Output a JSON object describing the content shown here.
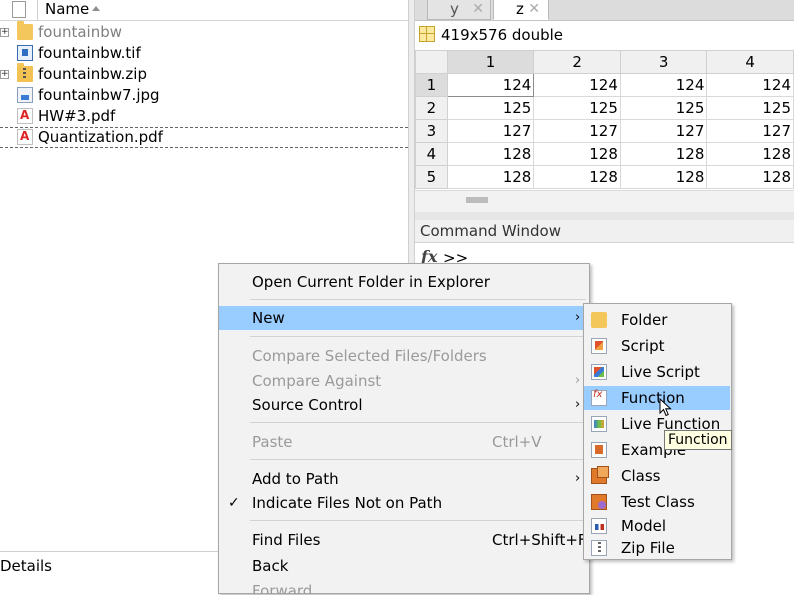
{
  "folder_panel": {
    "name_header": "Name",
    "files": [
      {
        "name": "fountainbw",
        "icon": "folder-icon",
        "expandable": true,
        "dim": true
      },
      {
        "name": "fountainbw.tif",
        "icon": "image-file-icon",
        "expandable": false,
        "dim": false
      },
      {
        "name": "fountainbw.zip",
        "icon": "zip-folder-icon",
        "expandable": true,
        "dim": false
      },
      {
        "name": "fountainbw7.jpg",
        "icon": "image-file-icon",
        "expandable": false,
        "dim": false
      },
      {
        "name": "HW#3.pdf",
        "icon": "pdf-file-icon",
        "expandable": false,
        "dim": false
      },
      {
        "name": "Quantization.pdf",
        "icon": "pdf-file-icon",
        "expandable": false,
        "dim": false
      }
    ],
    "details_label": "Details"
  },
  "variables": {
    "tabs": [
      {
        "label": "y",
        "close": "✕"
      },
      {
        "label": "z",
        "close": "✕"
      }
    ],
    "dims": "419x576 double",
    "columns": [
      "1",
      "2",
      "3",
      "4"
    ],
    "rows": [
      {
        "index": "1",
        "values": [
          "124",
          "124",
          "124",
          "124"
        ]
      },
      {
        "index": "2",
        "values": [
          "125",
          "125",
          "125",
          "125"
        ]
      },
      {
        "index": "3",
        "values": [
          "127",
          "127",
          "127",
          "127"
        ]
      },
      {
        "index": "4",
        "values": [
          "128",
          "128",
          "128",
          "128"
        ]
      },
      {
        "index": "5",
        "values": [
          "128",
          "128",
          "128",
          "128"
        ]
      }
    ]
  },
  "command_window": {
    "title": "Command Window",
    "fx": "fx",
    "prompt": ">>"
  },
  "context_menu": {
    "open_in_explorer": "Open Current Folder in Explorer",
    "new": "New",
    "compare_selected": "Compare Selected Files/Folders",
    "compare_against": "Compare Against",
    "source_control": "Source Control",
    "paste": "Paste",
    "paste_shortcut": "Ctrl+V",
    "add_to_path": "Add to Path",
    "indicate_not_on_path": "Indicate Files Not on Path",
    "find_files": "Find Files",
    "find_files_shortcut": "Ctrl+Shift+F",
    "back": "Back",
    "forward": "Forward",
    "submenu_arrow": "›",
    "check": "✓"
  },
  "new_submenu": {
    "items": [
      {
        "label": "Folder",
        "icon": "folder-icon"
      },
      {
        "label": "Script",
        "icon": "script-icon"
      },
      {
        "label": "Live Script",
        "icon": "live-script-icon"
      },
      {
        "label": "Function",
        "icon": "function-icon"
      },
      {
        "label": "Live Function",
        "icon": "live-function-icon"
      },
      {
        "label": "Example",
        "icon": "example-icon"
      },
      {
        "label": "Class",
        "icon": "class-icon"
      },
      {
        "label": "Test Class",
        "icon": "test-class-icon"
      },
      {
        "label": "Model",
        "icon": "model-icon"
      },
      {
        "label": "Zip File",
        "icon": "zip-file-icon"
      }
    ],
    "highlighted": "Function"
  },
  "tooltip": "Function",
  "colors": {
    "highlight": "#99ccff",
    "menu_background": "#f2f2f2",
    "tooltip_background": "#ffffe1",
    "disabled_text": "#9a9a9a"
  }
}
